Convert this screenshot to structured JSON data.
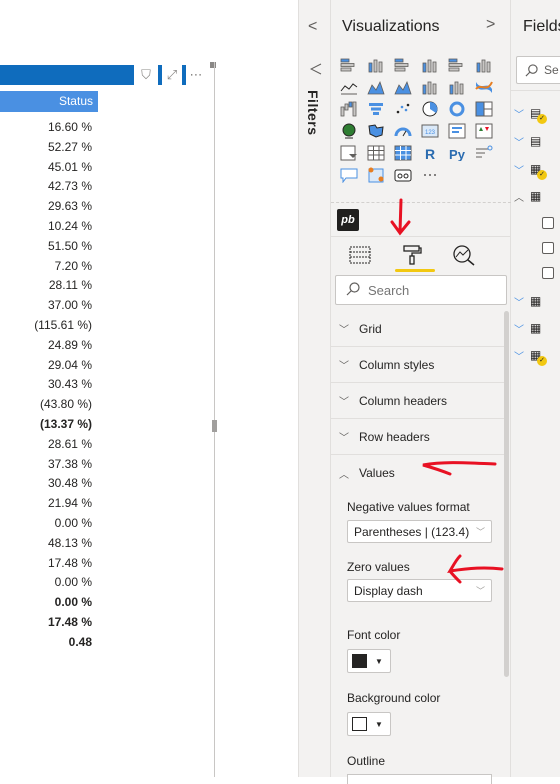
{
  "table_visual": {
    "header_buttons": [
      {
        "name": "filter",
        "glyph": "⛉"
      },
      {
        "name": "focus-mode",
        "glyph": "⤢"
      },
      {
        "name": "more-options",
        "glyph": "⋯"
      }
    ],
    "column_header": "Status",
    "rows": [
      {
        "value": "16.60 %",
        "bold": false
      },
      {
        "value": "52.27 %",
        "bold": false
      },
      {
        "value": "45.01 %",
        "bold": false
      },
      {
        "value": "42.73 %",
        "bold": false
      },
      {
        "value": "29.63 %",
        "bold": false
      },
      {
        "value": "10.24 %",
        "bold": false
      },
      {
        "value": "51.50 %",
        "bold": false
      },
      {
        "value": "7.20 %",
        "bold": false
      },
      {
        "value": "28.11 %",
        "bold": false
      },
      {
        "value": "37.00 %",
        "bold": false
      },
      {
        "value": "(115.61 %)",
        "bold": false
      },
      {
        "value": "24.89 %",
        "bold": false
      },
      {
        "value": "29.04 %",
        "bold": false
      },
      {
        "value": "30.43 %",
        "bold": false
      },
      {
        "value": "(43.80 %)",
        "bold": false
      },
      {
        "value": "(13.37 %)",
        "bold": true
      },
      {
        "value": "28.61 %",
        "bold": false
      },
      {
        "value": "37.38 %",
        "bold": false
      },
      {
        "value": "30.48 %",
        "bold": false
      },
      {
        "value": "21.94 %",
        "bold": false
      },
      {
        "value": "0.00 %",
        "bold": false
      },
      {
        "value": "48.13 %",
        "bold": false
      },
      {
        "value": "17.48 %",
        "bold": false
      },
      {
        "value": "0.00 %",
        "bold": false
      },
      {
        "value": "0.00 %",
        "bold": true
      },
      {
        "value": "17.48 %",
        "bold": true
      },
      {
        "value": "0.48",
        "bold": true
      }
    ]
  },
  "filters_pane": {
    "collapse_glyph": "<",
    "label": "Filters"
  },
  "visualizations_pane": {
    "title": "Visualizations",
    "expand_glyph": ">",
    "visual_icons": [
      "stacked-bar-chart-icon",
      "stacked-column-chart-icon",
      "clustered-bar-chart-icon",
      "clustered-column-chart-icon",
      "100-stacked-bar-chart-icon",
      "100-stacked-column-chart-icon",
      "line-chart-icon",
      "area-chart-icon",
      "stacked-area-chart-icon",
      "line-stacked-column-chart-icon",
      "line-clustered-column-chart-icon",
      "ribbon-chart-icon",
      "waterfall-chart-icon",
      "funnel-chart-icon",
      "scatter-chart-icon",
      "pie-chart-icon",
      "donut-chart-icon",
      "treemap-icon",
      "map-icon",
      "filled-map-icon",
      "gauge-icon",
      "card-icon",
      "multi-row-card-icon",
      "kpi-icon",
      "slicer-icon",
      "table-icon",
      "matrix-icon",
      "r-visual-icon",
      "python-visual-icon",
      "key-influencers-icon",
      "qna-icon",
      "decomposition-tree-icon",
      "smart-narrative-icon",
      "more-visuals-icon"
    ],
    "custom_visual": "pb",
    "tabs": [
      {
        "name": "fields-tab",
        "active": false
      },
      {
        "name": "format-tab",
        "active": true
      },
      {
        "name": "analytics-tab",
        "active": false
      }
    ],
    "search_placeholder": "Search",
    "sections": [
      {
        "label": "Grid",
        "expanded": false
      },
      {
        "label": "Column styles",
        "expanded": false
      },
      {
        "label": "Column headers",
        "expanded": false
      },
      {
        "label": "Row headers",
        "expanded": false
      },
      {
        "label": "Values",
        "expanded": true
      }
    ],
    "values_section": {
      "negative_format_label": "Negative values format",
      "negative_format_value": "Parentheses | (123.4)",
      "zero_values_label": "Zero values",
      "zero_values_value": "Display dash",
      "font_color_label": "Font color",
      "font_color": "#252423",
      "background_color_label": "Background color",
      "background_color": "#ffffff",
      "outline_label": "Outline"
    }
  },
  "fields_pane": {
    "title": "Fields",
    "search_placeholder": "Se",
    "tables": [
      {
        "icon": "measure-table-icon",
        "expanded": false,
        "badge": true
      },
      {
        "icon": "calculator-table-icon",
        "expanded": false,
        "badge": false
      },
      {
        "icon": "table-icon",
        "expanded": false,
        "badge": true
      },
      {
        "icon": "table-icon",
        "expanded": true,
        "badge": false
      },
      {
        "icon": "table-icon",
        "expanded": false,
        "badge": false
      },
      {
        "icon": "table-icon",
        "expanded": false,
        "badge": false
      },
      {
        "icon": "table-icon",
        "expanded": false,
        "badge": true
      }
    ],
    "field_checkboxes": 3
  },
  "colors": {
    "accent_blue": "#0f6cbd",
    "header_blue": "#4a90e2",
    "active_tab_yellow": "#f2c811",
    "annotation_red": "#e81123"
  }
}
